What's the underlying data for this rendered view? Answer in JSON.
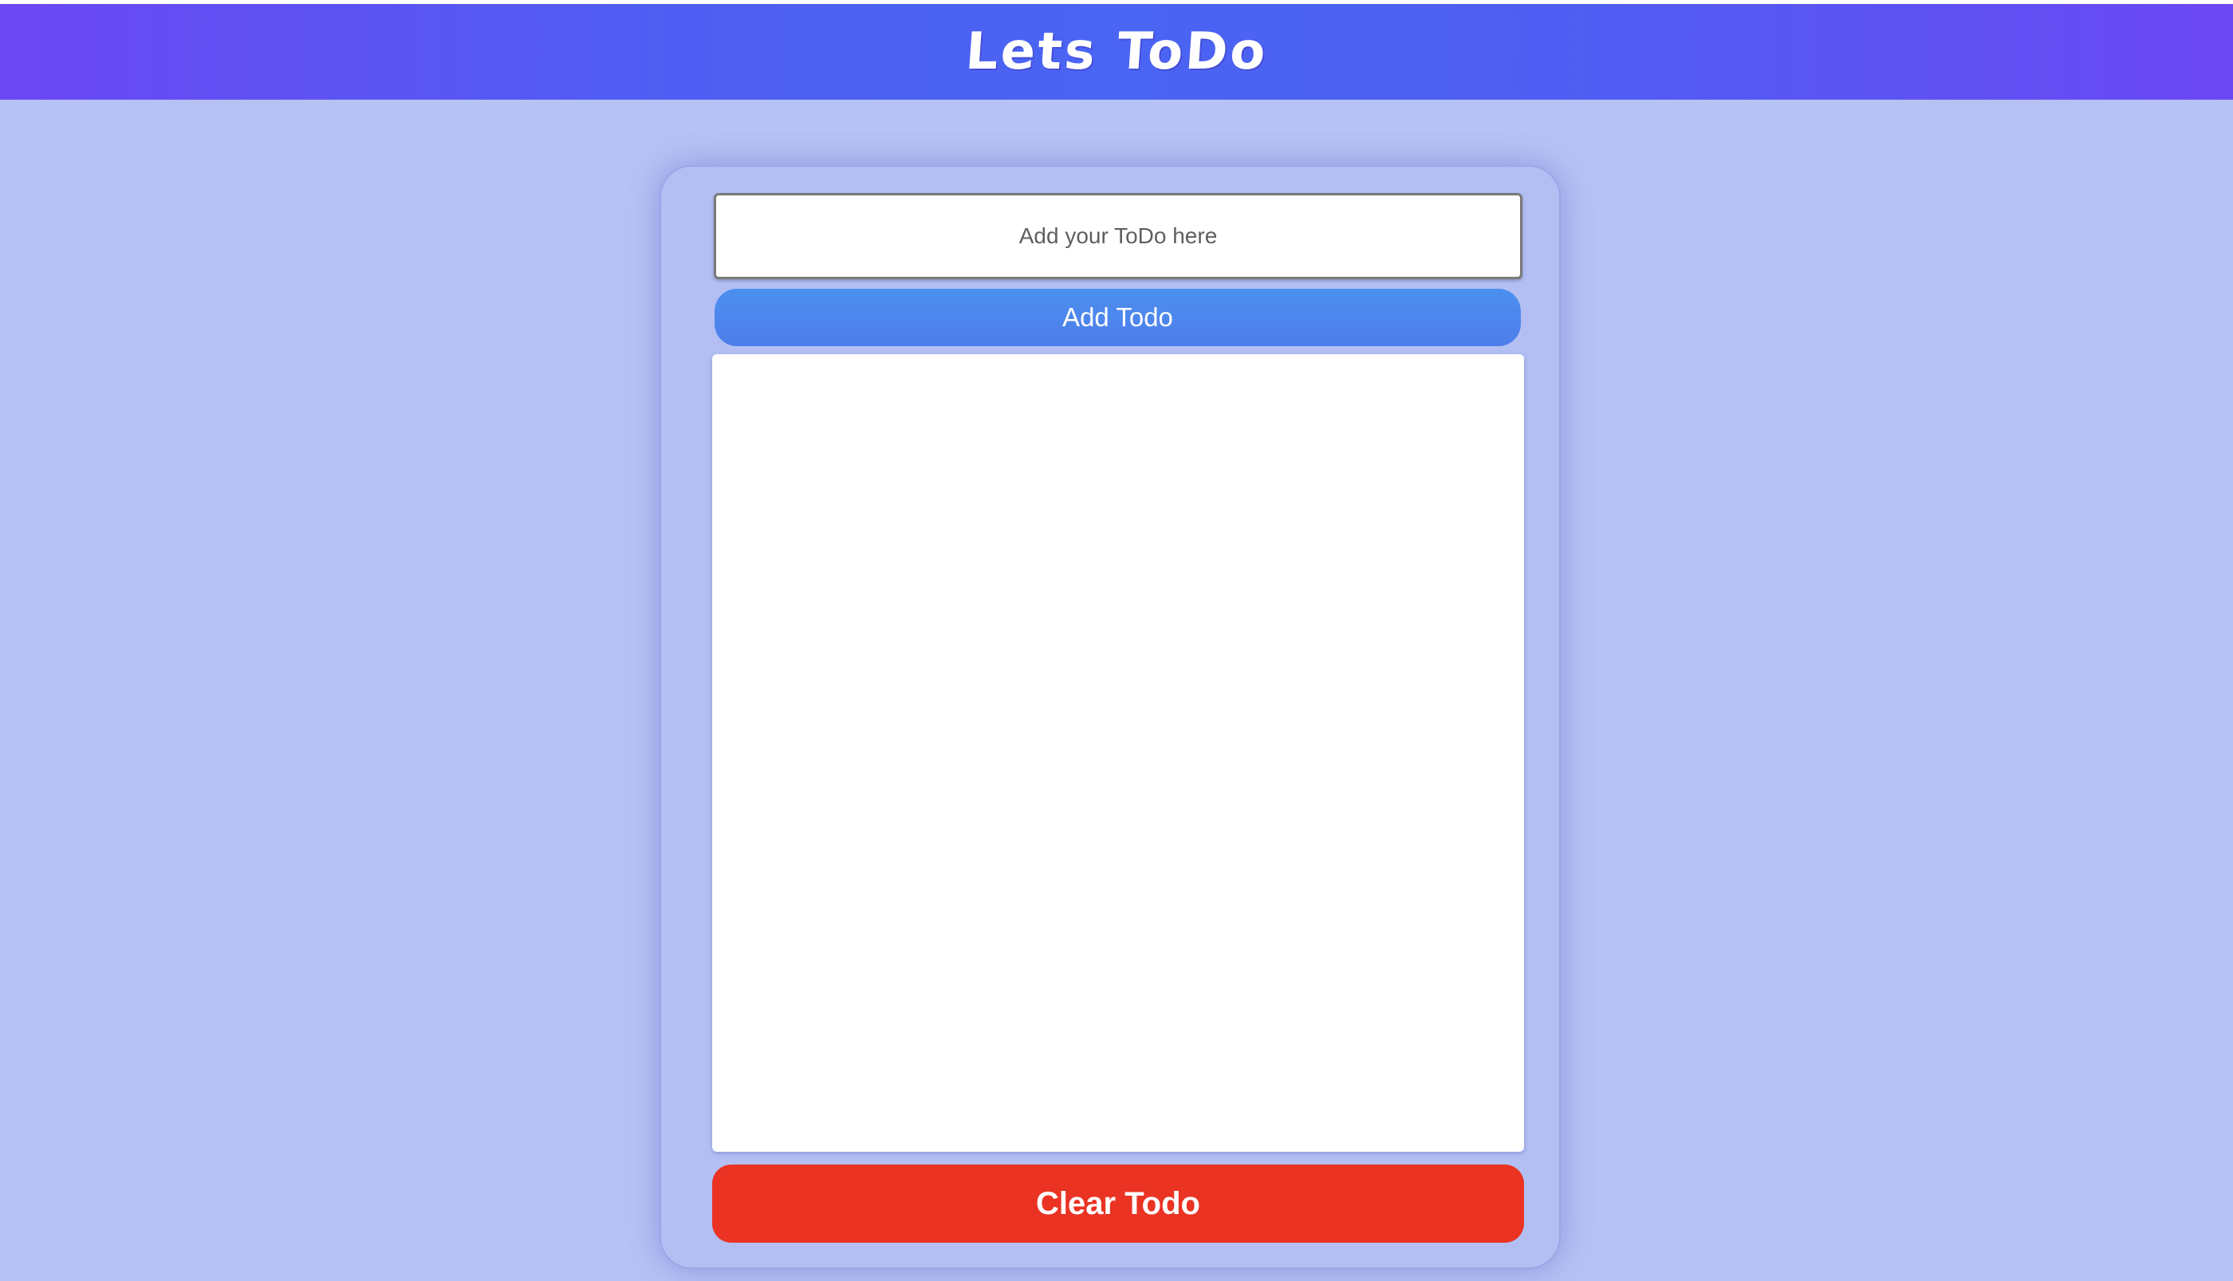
{
  "header": {
    "title": "Lets ToDo"
  },
  "todo_form": {
    "input_placeholder": "Add your ToDo here",
    "input_value": "",
    "add_label": "Add Todo"
  },
  "todo_list": {
    "items": []
  },
  "actions": {
    "clear_label": "Clear Todo"
  },
  "colors": {
    "background": "#b6c2f4",
    "header_gradient_edge": "#6b47f3",
    "header_gradient_center": "#4a64f3",
    "add_button": "#4a90ef",
    "clear_button": "#ea3323"
  }
}
